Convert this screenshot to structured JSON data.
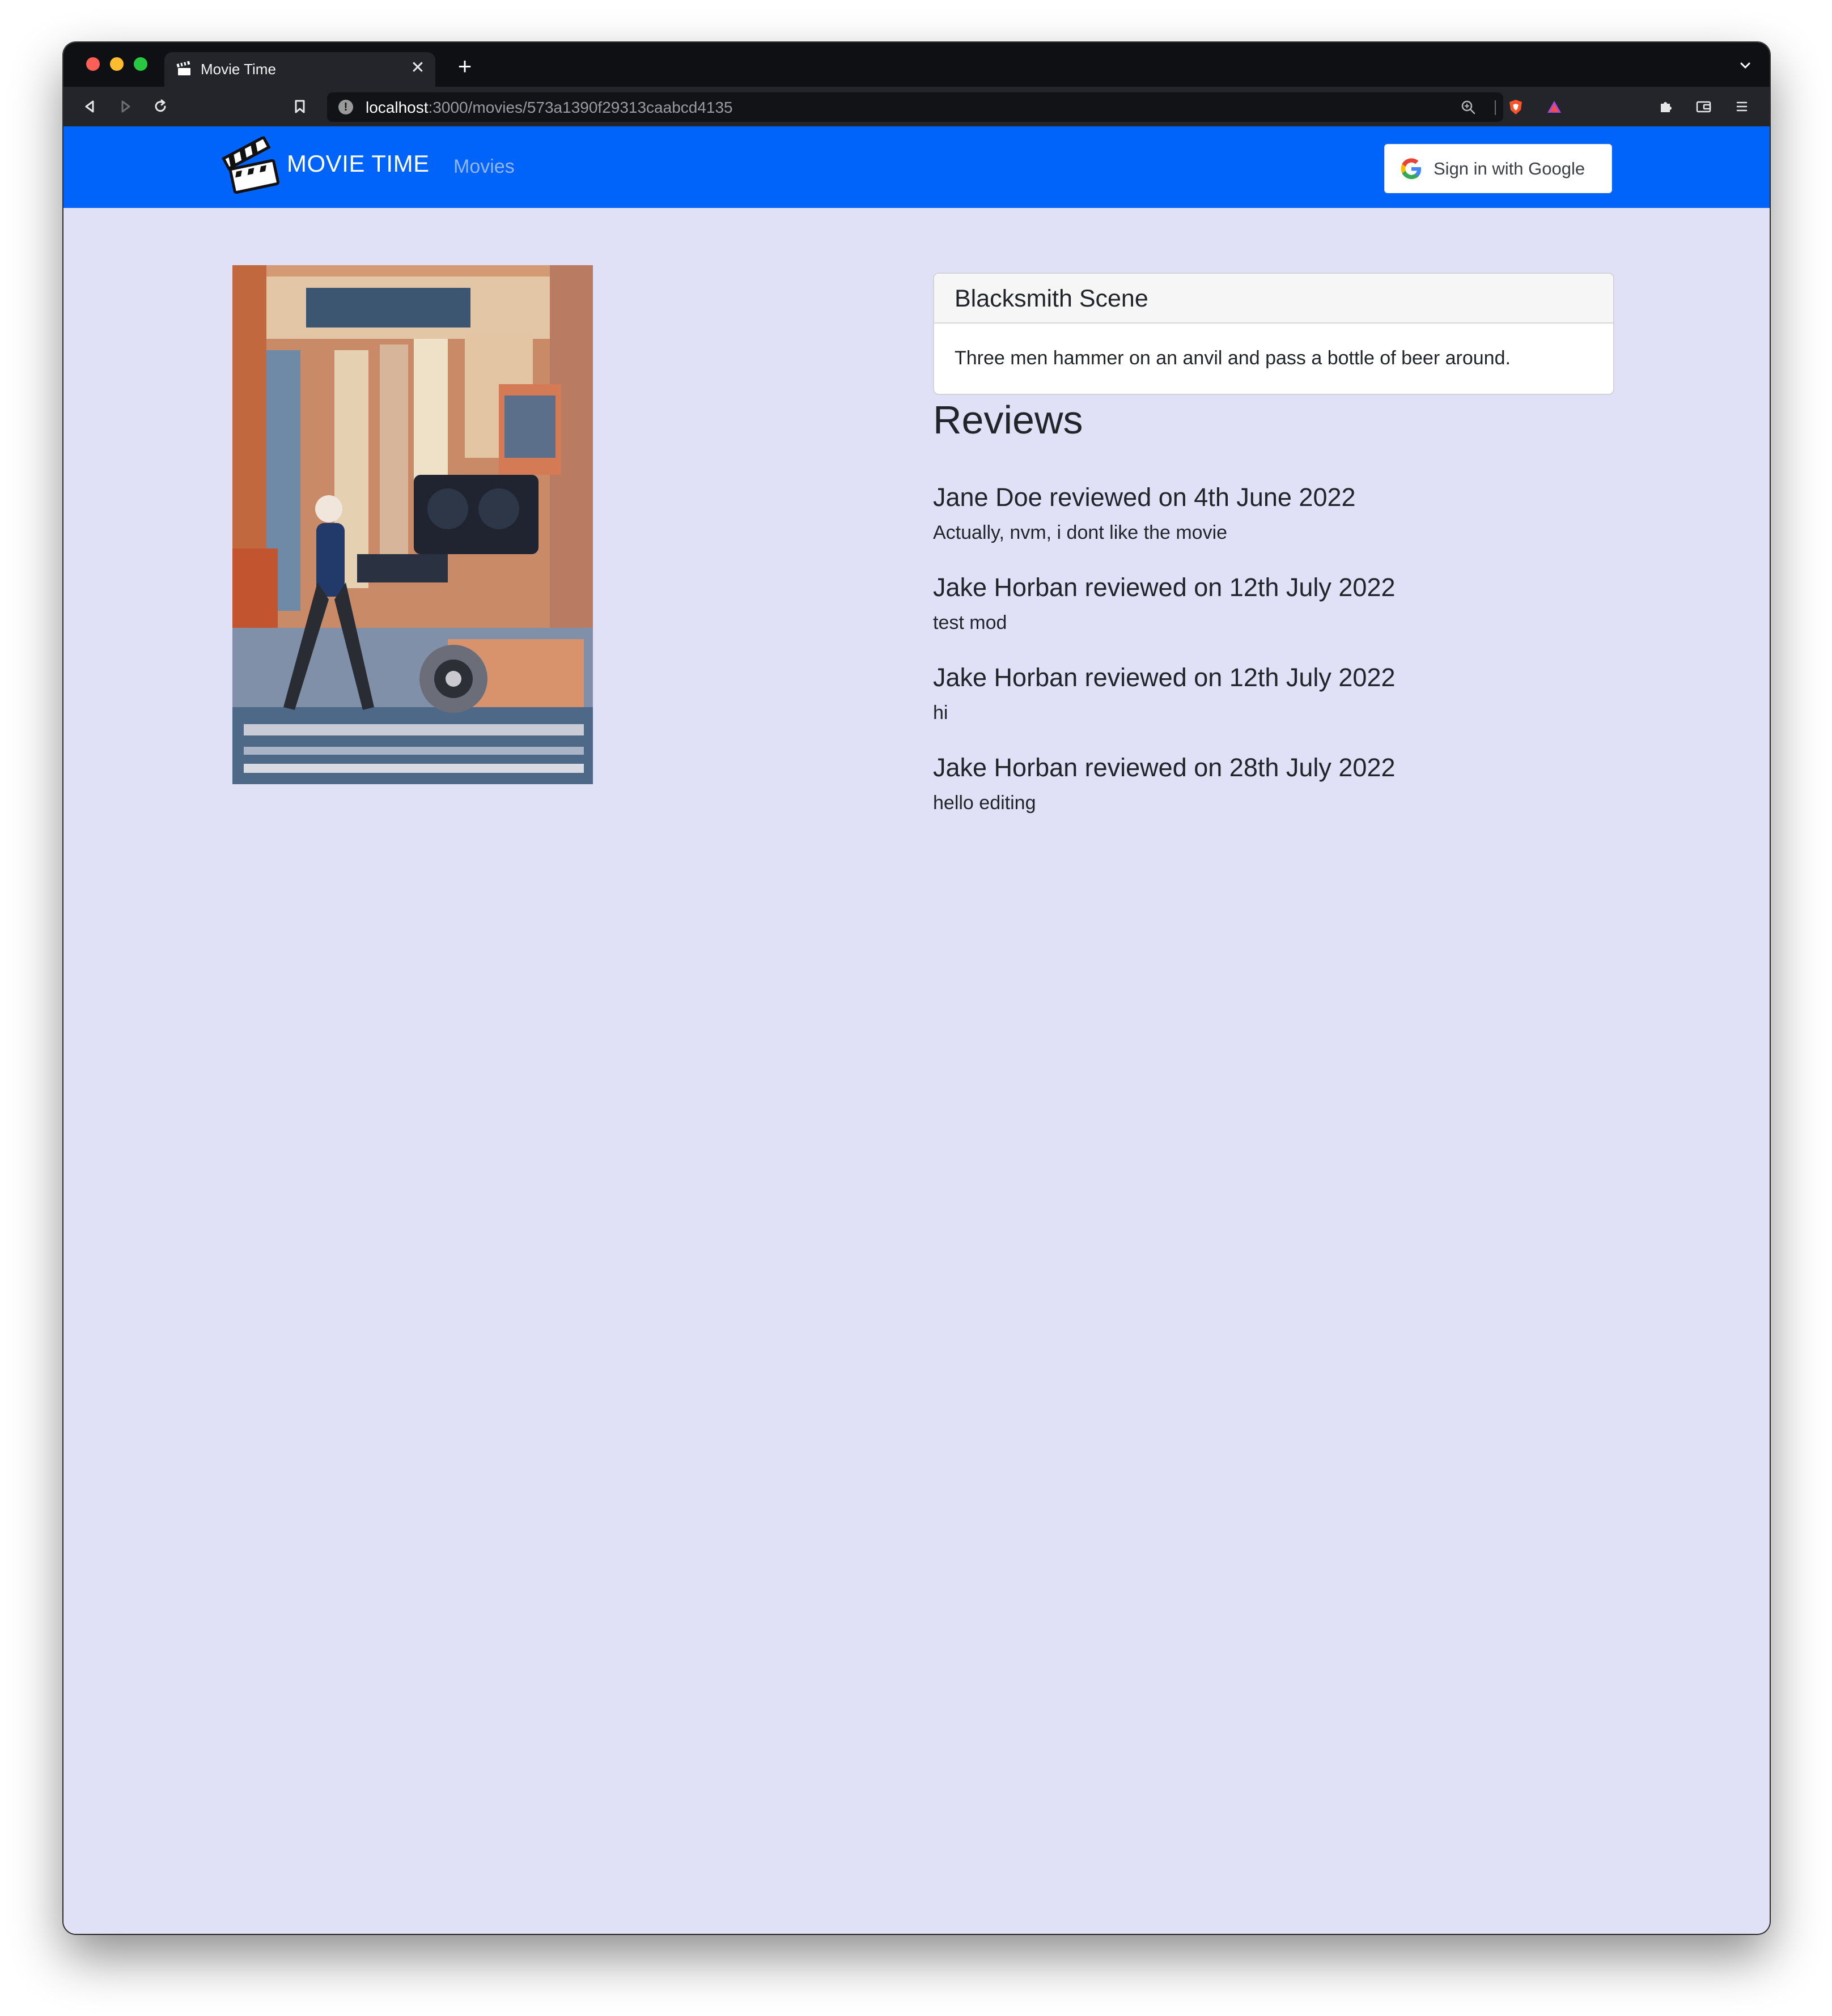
{
  "browser": {
    "tab_title": "Movie Time",
    "url_host": "localhost",
    "url_path": ":3000/movies/573a1390f29313caabcd4135",
    "icons": {
      "back": "back-arrow-icon",
      "forward": "forward-arrow-icon",
      "reload": "reload-icon",
      "bookmark": "bookmark-icon",
      "site_info": "info-icon",
      "zoom": "zoom-icon",
      "brave": "brave-shield-icon",
      "rewards": "rewards-triangle-icon",
      "extensions": "puzzle-icon",
      "wallet": "wallet-icon",
      "menu": "hamburger-menu-icon"
    }
  },
  "navbar": {
    "brand": "MOVIE TIME",
    "movies_link": "Movies",
    "sign_in_label": "Sign in with Google",
    "background": "#0064fa"
  },
  "movie": {
    "title": "Blacksmith Scene",
    "plot": "Three men hammer on an anvil and pass a bottle of beer around."
  },
  "reviews": {
    "heading": "Reviews",
    "items": [
      {
        "title": "Jane Doe reviewed on 4th June 2022",
        "text": "Actually, nvm, i dont like the movie"
      },
      {
        "title": "Jake Horban reviewed on 12th July 2022",
        "text": "test mod"
      },
      {
        "title": "Jake Horban reviewed on 12th July 2022",
        "text": "hi"
      },
      {
        "title": "Jake Horban reviewed on 28th July 2022",
        "text": "hello editing"
      }
    ]
  }
}
